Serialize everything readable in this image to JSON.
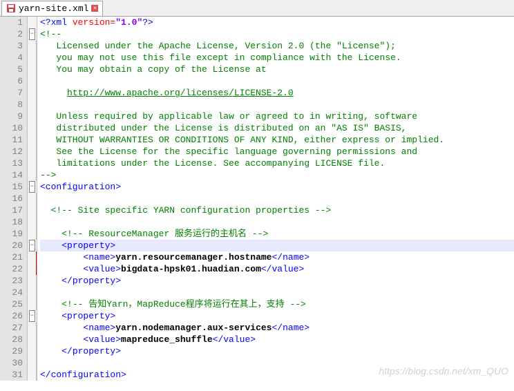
{
  "tab": {
    "filename": "yarn-site.xml"
  },
  "code": {
    "xml_decl_open": "<?xml ",
    "xml_attr": "version=",
    "xml_ver": "\"1.0\"",
    "xml_decl_close": "?>",
    "c_open": "<!--",
    "c_close": "-->",
    "lic1": "   Licensed under the Apache License, Version 2.0 (the \"License\");",
    "lic2": "   you may not use this file except in compliance with the License.",
    "lic3": "   You may obtain a copy of the License at",
    "lic_url": "http://www.apache.org/licenses/LICENSE-2.0",
    "lic4": "   Unless required by applicable law or agreed to in writing, software",
    "lic5": "   distributed under the License is distributed on an \"AS IS\" BASIS,",
    "lic6": "   WITHOUT WARRANTIES OR CONDITIONS OF ANY KIND, either express or implied.",
    "lic7": "   See the License for the specific language governing permissions and",
    "lic8": "   limitations under the License. See accompanying LICENSE file.",
    "tag_config_open": "<configuration>",
    "tag_config_close": "</configuration>",
    "c_site": "<!-- Site specific YARN configuration properties -->",
    "c_rm": "<!-- ResourceManager 服务运行的主机名 -->",
    "tag_prop_open": "<property>",
    "tag_prop_close": "</property>",
    "tag_name_open": "<name>",
    "tag_name_close": "</name>",
    "tag_value_open": "<value>",
    "tag_value_close": "</value>",
    "prop1_name": "yarn.resourcemanager.hostname",
    "prop1_value": "bigdata-hpsk01.huadian.com",
    "c_aux": "<!-- 告知Yarn，MapReduce程序将运行在其上，支持 -->",
    "prop2_name": "yarn.nodemanager.aux-services",
    "prop2_value": "mapreduce_shuffle"
  },
  "watermark": "https://blog.csdn.net/xm_QUO"
}
